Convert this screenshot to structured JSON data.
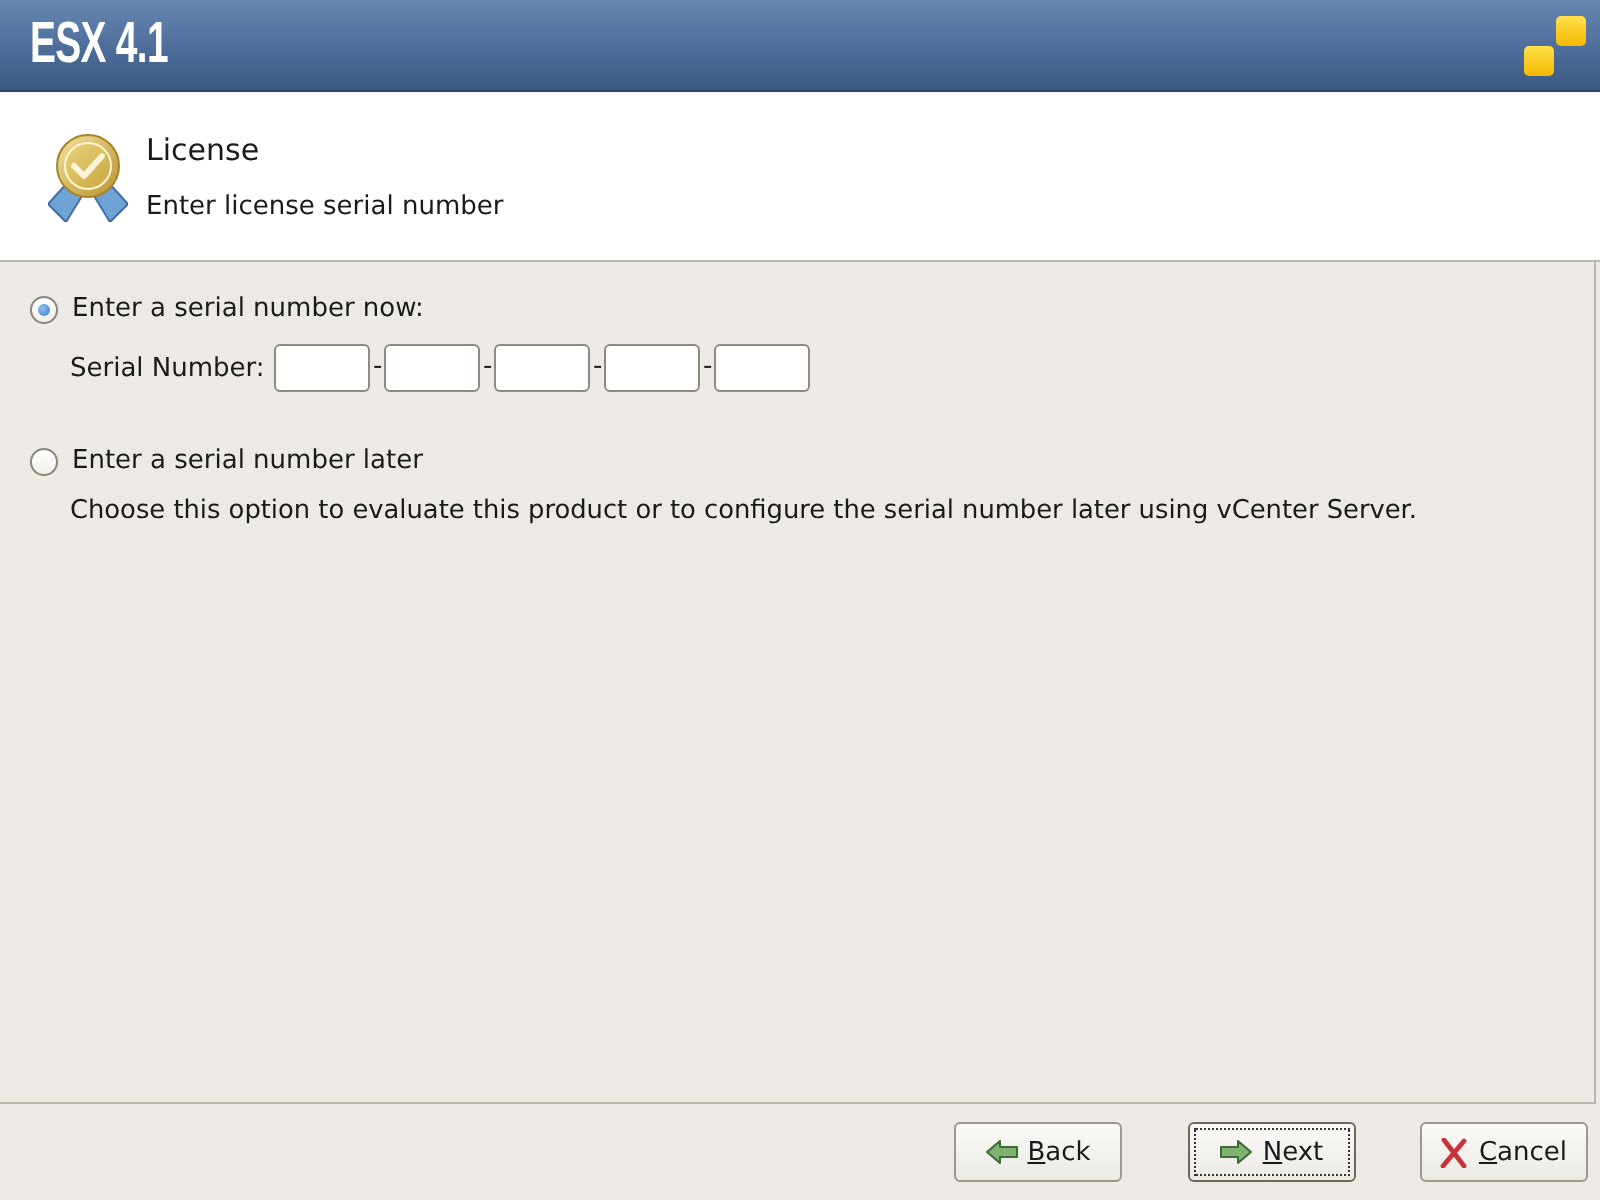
{
  "header": {
    "product_title": "ESX 4.1"
  },
  "page": {
    "title": "License",
    "subtitle": "Enter license serial number"
  },
  "options": [
    {
      "kind": "serial",
      "label": "Enter a serial number now:",
      "selected": true,
      "field_label": "Serial Number:",
      "serial_parts": [
        {
          "kind": "field"
        },
        {
          "kind": "separator",
          "text": "-"
        },
        {
          "kind": "field"
        },
        {
          "kind": "separator",
          "text": "-"
        },
        {
          "kind": "field"
        },
        {
          "kind": "separator",
          "text": "-"
        },
        {
          "kind": "field"
        },
        {
          "kind": "separator",
          "text": "-"
        },
        {
          "kind": "field"
        }
      ]
    },
    {
      "kind": "note",
      "label": "Enter a serial number later",
      "selected": false,
      "description": "Choose this option to evaluate this product or to configure the serial number later using vCenter Server."
    }
  ],
  "buttons": [
    {
      "kind": "back",
      "label": "Back",
      "underline_first_letter": true,
      "focused": false
    },
    {
      "kind": "next",
      "label": "Next",
      "underline_first_letter": true,
      "focused": true
    },
    {
      "kind": "cancel",
      "label": "Cancel",
      "underline_first_letter": true,
      "focused": false
    }
  ]
}
